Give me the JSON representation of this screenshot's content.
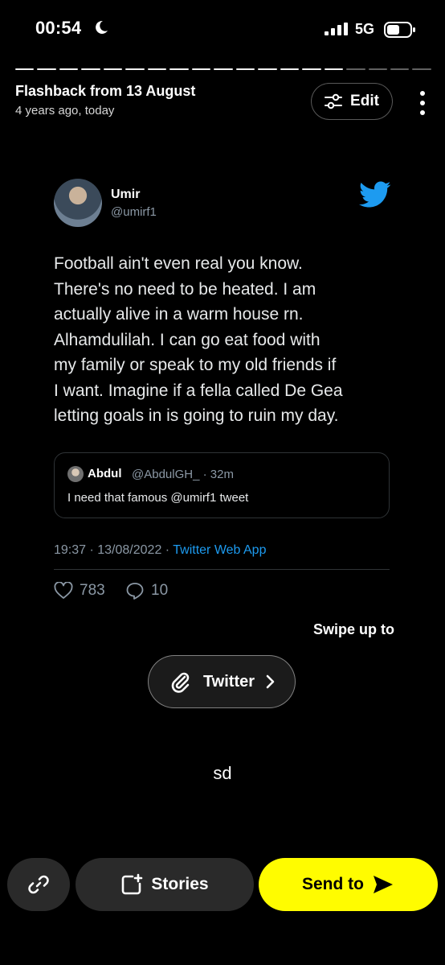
{
  "status_bar": {
    "time": "00:54",
    "network": "5G"
  },
  "story": {
    "title": "Flashback from 13 August",
    "subtitle": "4 years ago, today",
    "edit_label": "Edit",
    "progress": {
      "segments": 19,
      "completed": 15
    }
  },
  "tweet": {
    "author_name": "Umir",
    "author_handle": "@umirf1",
    "text_lines": [
      "Football ain't even real you know.",
      "There's no need to be heated. I am",
      "actually alive in a warm house rn.",
      "Alhamdulilah. I can go eat food with",
      "my family or speak to my old friends if",
      "I want. Imagine if a fella called De Gea",
      "letting goals in is going to ruin my day."
    ],
    "quote": {
      "name": "Abdul",
      "handle_time": "@AbdulGH_ · 32m",
      "text": "I need that famous @umirf1 tweet"
    },
    "meta_datetime": "19:37 · 13/08/2022 · ",
    "meta_source": "Twitter Web App",
    "likes": "783",
    "replies": "10"
  },
  "swipe_text": "Swipe up to",
  "attachment_label": "Twitter",
  "caption": "sd",
  "bottom_bar": {
    "stories_label": "Stories",
    "send_label": "Send to"
  },
  "colors": {
    "accent_yellow": "#fffc00",
    "twitter_blue": "#1d9bf0",
    "muted": "#8b98a5"
  }
}
